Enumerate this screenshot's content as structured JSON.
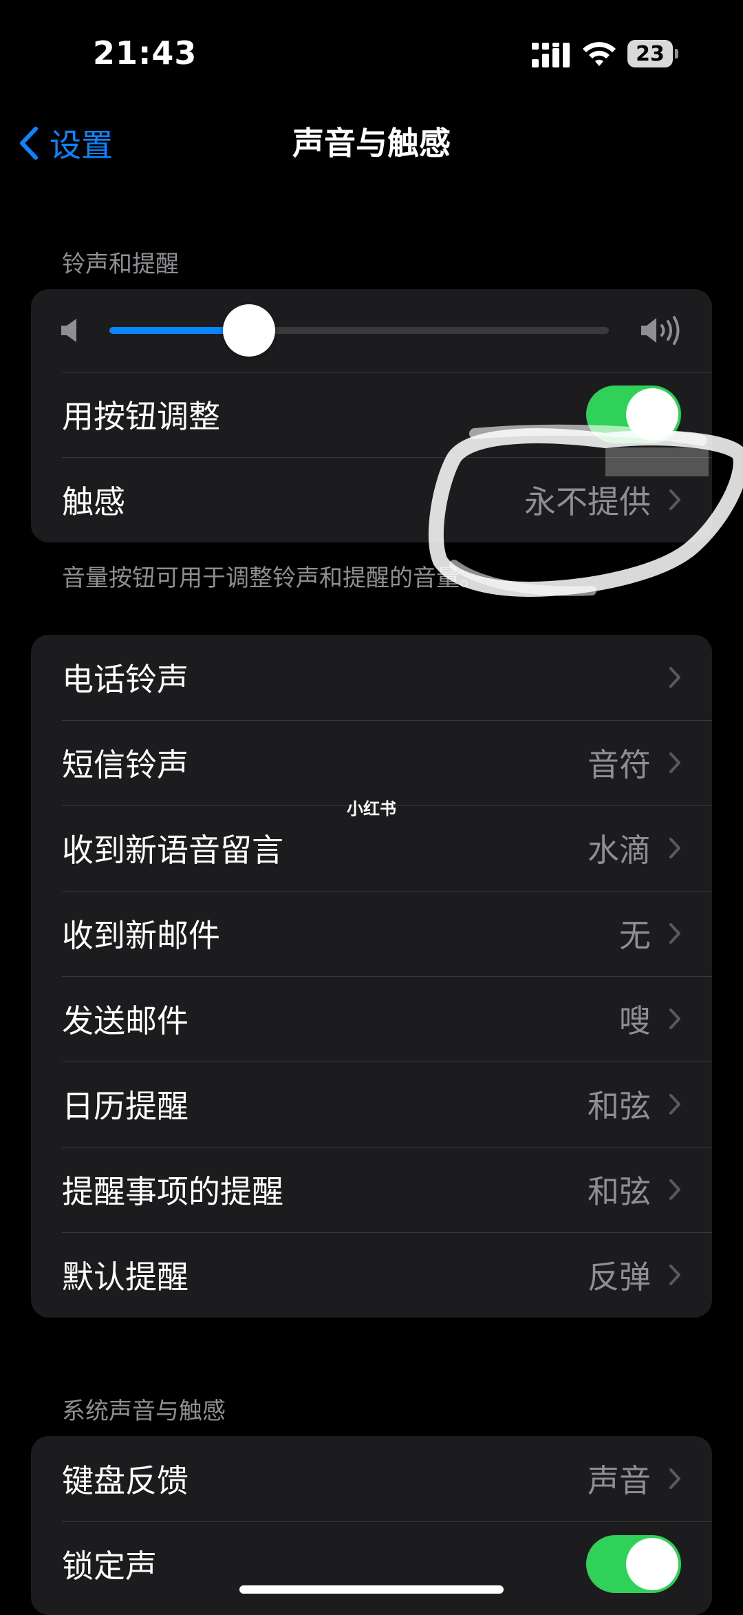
{
  "status_bar": {
    "time": "21:43",
    "battery": "23",
    "icons": [
      "signal-icon",
      "wifi-icon",
      "battery-icon"
    ]
  },
  "nav": {
    "back_label": "设置",
    "title": "声音与触感"
  },
  "ringtone_section": {
    "header": "铃声和提醒",
    "volume_level": 0.28,
    "change_with_buttons_label": "用按钮调整",
    "change_with_buttons_on": true,
    "haptics_label": "触感",
    "haptics_value": "永不提供",
    "footer": "音量按钮可用于调整铃声和提醒的音量。"
  },
  "sounds": [
    {
      "label": "电话铃声",
      "value": ""
    },
    {
      "label": "短信铃声",
      "value": "音符"
    },
    {
      "label": "收到新语音留言",
      "value": "水滴"
    },
    {
      "label": "收到新邮件",
      "value": "无"
    },
    {
      "label": "发送邮件",
      "value": "嗖"
    },
    {
      "label": "日历提醒",
      "value": "和弦"
    },
    {
      "label": "提醒事项的提醒",
      "value": "和弦"
    },
    {
      "label": "默认提醒",
      "value": "反弹"
    }
  ],
  "system_section": {
    "header": "系统声音与触感",
    "keyboard_feedback_label": "键盘反馈",
    "keyboard_feedback_value": "声音",
    "lock_sound_label": "锁定声",
    "lock_sound_on": true
  },
  "watermark": "小红书",
  "colors": {
    "accent": "#0a84ff",
    "toggle_on": "#30d158",
    "background": "#000000",
    "group_bg": "#1c1c1e",
    "secondary_text": "#8e8e93"
  }
}
